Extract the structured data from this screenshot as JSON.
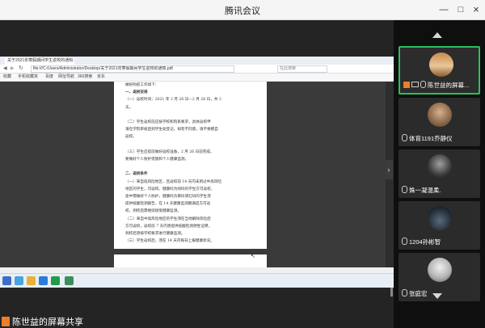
{
  "window": {
    "title": "腾讯会议",
    "minimize_icon": "minimize-icon",
    "maximize_icon": "maximize-icon",
    "close_icon": "close-icon"
  },
  "share_view": {
    "sharer_label": "陈世益的屏幕共享",
    "browser": {
      "tab_title": "关于2021年寒假期间学生返校的通知...",
      "address": "file:///C:/Users/Administrator/Desktop/关于2021年寒假期间学生返校的通知.pdf",
      "search_placeholder": "在此搜索",
      "bookmarks": [
        "收藏",
        "手机收藏夹",
        "百度",
        "网址导航",
        "360搜索",
        "京东"
      ],
      "document_lines": [
        {
          "text": "做好防疫工作如下：",
          "heading": false
        },
        {
          "text": "一、返校安排",
          "heading": true
        },
        {
          "text": "（一）返校时间：2021 年 2 月 26 日—2 月 28 日，共 3",
          "heading": false
        },
        {
          "text": "天。",
          "heading": false
        },
        {
          "text": "",
          "heading": false
        },
        {
          "text": "（二）学生返校前应按学校和院系要求，具体返校申",
          "heading": false
        },
        {
          "text": "请在学院审核后到学生处登记，如有不同意，请不要擅自",
          "heading": false
        },
        {
          "text": "返校。",
          "heading": false
        },
        {
          "text": "",
          "heading": false
        },
        {
          "text": "（三）学生应提前做好返校准备，2 月 26 日前完成，",
          "heading": false
        },
        {
          "text": "要做好个人防护措施和个人健康监测。",
          "heading": false
        },
        {
          "text": "",
          "heading": false
        },
        {
          "text": "二、返校条件",
          "heading": true
        },
        {
          "text": "（一）来自低风险地区，且返校前 14 天内未到过中高风险",
          "heading": false
        },
        {
          "text": "地区的学生，可返校。健康码为绿码的学生方可返校，",
          "heading": false
        },
        {
          "text": "途中需做好个人防护，健康码为黄码或红码的学生须",
          "heading": false
        },
        {
          "text": "提供核酸检测报告，在 14 天健康监测期满后方可返",
          "heading": false
        },
        {
          "text": "校，到校后需继续接受健康监测。",
          "heading": false
        },
        {
          "text": "（二）来自中高风险地区的学生须在当地解除风险后",
          "heading": false
        },
        {
          "text": "方可返校，返校前 7 天内须提供核酸检测阴性证明，",
          "heading": false
        },
        {
          "text": "到校后须按学校要求进行健康监测。",
          "heading": false
        },
        {
          "text": "（三）学生返校后，须在 14 天内每日上报健康状况。",
          "heading": false
        }
      ]
    }
  },
  "participants": [
    {
      "name": "陈世益的屏幕...",
      "active": true,
      "host": true
    },
    {
      "name": "体育1191乔静仪",
      "active": false,
      "host": false
    },
    {
      "name": "姝一凝温柔.",
      "active": false,
      "host": false
    },
    {
      "name": "1204孙彬智",
      "active": false,
      "host": false
    },
    {
      "name": "张庭宏",
      "active": false,
      "host": false
    }
  ]
}
